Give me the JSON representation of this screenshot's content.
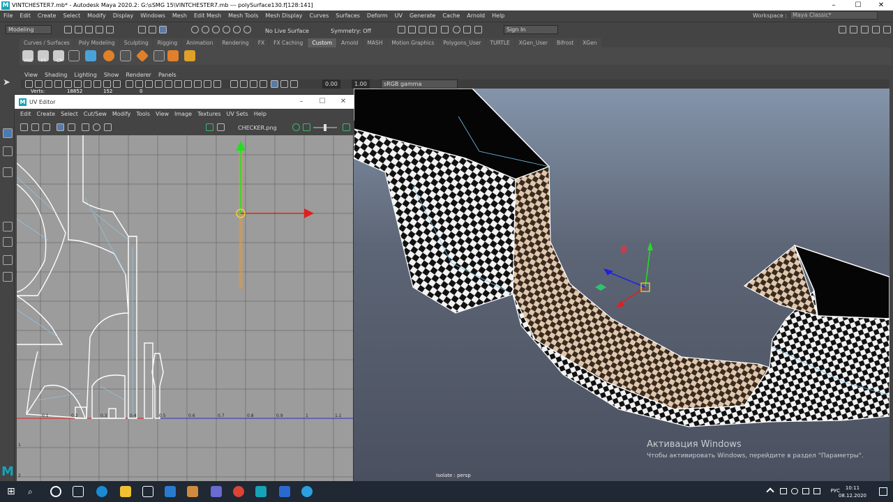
{
  "window": {
    "title": "VINTCHESTER7.mb* - Autodesk Maya 2020.2: G:\\sSMG 15\\VINTCHESTER7.mb   ---   polySurface130.f[128:141]",
    "minimize": "–",
    "maximize": "☐",
    "close": "✕",
    "logo": "M"
  },
  "menubar": [
    "File",
    "Edit",
    "Create",
    "Select",
    "Modify",
    "Display",
    "Windows",
    "Mesh",
    "Edit Mesh",
    "Mesh Tools",
    "Mesh Display",
    "Curves",
    "Surfaces",
    "Deform",
    "UV",
    "Generate",
    "Cache",
    "Arnold",
    "Help"
  ],
  "workspace": {
    "label": "Workspace :",
    "value": "Maya Classic*"
  },
  "status": {
    "mode": "Modeling",
    "live": "No Live Surface",
    "symmetry": "Symmetry: Off",
    "signin": "Sign In"
  },
  "shelf_tabs": [
    "Curves / Surfaces",
    "Poly Modeling",
    "Sculpting",
    "Rigging",
    "Animation",
    "Rendering",
    "FX",
    "FX Caching",
    "Custom",
    "Arnold",
    "MASH",
    "Motion Graphics",
    "Polygons_User",
    "TURTLE",
    "XGen_User",
    "Bifrost",
    "XGen"
  ],
  "shelf_active": "Custom",
  "shelf_labels": [
    "Hist",
    "FT",
    "CP"
  ],
  "viewport": {
    "menu": [
      "View",
      "Shading",
      "Lighting",
      "Show",
      "Renderer",
      "Panels"
    ],
    "exposure": "0.00",
    "gamma": "1.00",
    "colorspace": "sRGB gamma",
    "isolate": "Isolate : persp"
  },
  "hud": {
    "label": "Verts:",
    "v1": "18852",
    "v2": "152",
    "v3": "0"
  },
  "uv_editor": {
    "title": "UV Editor",
    "logo": "M",
    "menu": [
      "Edit",
      "Create",
      "Select",
      "Cut/Sew",
      "Modify",
      "Tools",
      "View",
      "Image",
      "Textures",
      "UV Sets",
      "Help"
    ],
    "image": "CHECKER.png",
    "ticks_u": [
      "0.1",
      "0.2",
      "0.3",
      "0.4",
      "0.5",
      "0.6",
      "0.7",
      "0.8",
      "0.9",
      "1",
      "1.1"
    ],
    "ticks_v": [
      "1",
      "2"
    ]
  },
  "watermark": {
    "line1": "Активация Windows",
    "line2": "Чтобы активировать Windows, перейдите в раздел \"Параметры\"."
  },
  "taskbar": {
    "lang": "РУС",
    "time": "10:11",
    "date": "08.12.2020"
  },
  "colors": {
    "maya_blue": "#16a3b8",
    "panel": "#444444",
    "uv_bg": "#9c9c9c",
    "red_axis": "#e02020",
    "green_axis": "#20e020",
    "blue_axis": "#2020e0"
  }
}
